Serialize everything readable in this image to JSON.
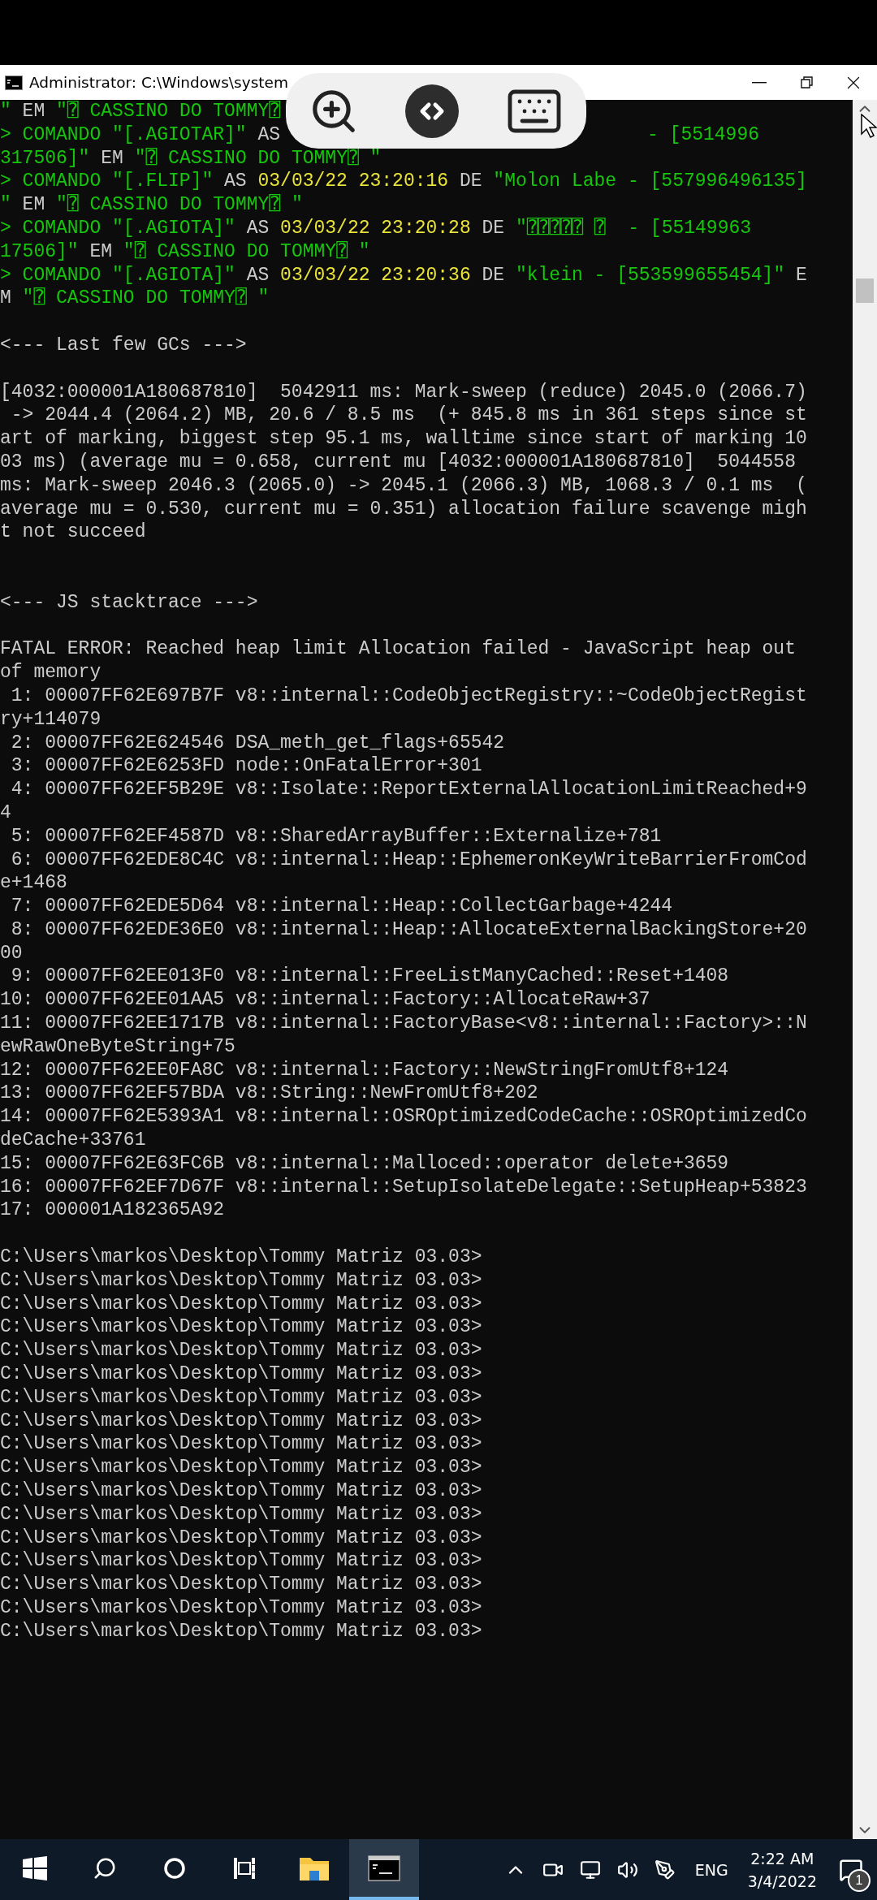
{
  "window": {
    "title": "Administrator: C:\\Windows\\system"
  },
  "console": {
    "lines": [
      {
        "kind": "covered",
        "left": [
          {
            "text": "\"",
            "color": "#16c60c"
          },
          {
            "text": " EM ",
            "color": "#cccccc"
          },
          {
            "text": "\"⍰ CASSINO DO TOMMY⍰",
            "color": "#16c60c"
          }
        ]
      },
      {
        "kind": "covered",
        "left": [
          {
            "text": "> COMANDO \"[.AGIOTAR]\"",
            "color": "#16c60c"
          },
          {
            "text": " AS",
            "color": "#cccccc"
          }
        ],
        "right": [
          {
            "text": "- [5514996",
            "color": "#16c60c"
          }
        ]
      },
      {
        "kind": "colored",
        "segments": [
          {
            "text": "317506]\"",
            "color": "#16c60c"
          },
          {
            "text": " EM ",
            "color": "#cccccc"
          },
          {
            "text": "\"⍰ CASSINO DO TOMMY⍰ \"",
            "color": "#16c60c"
          }
        ]
      },
      {
        "kind": "colored",
        "segments": [
          {
            "text": "> COMANDO \"[.FLIP]\"",
            "color": "#16c60c"
          },
          {
            "text": " AS ",
            "color": "#cccccc"
          },
          {
            "text": "03/03/22 23:20:16",
            "color": "#eae33a"
          },
          {
            "text": " DE ",
            "color": "#cccccc"
          },
          {
            "text": "\"Molon Labe - [557996496135]",
            "color": "#16c60c"
          }
        ]
      },
      {
        "kind": "colored",
        "segments": [
          {
            "text": "\"",
            "color": "#16c60c"
          },
          {
            "text": " EM ",
            "color": "#cccccc"
          },
          {
            "text": "\"⍰ CASSINO DO TOMMY⍰ \"",
            "color": "#16c60c"
          }
        ]
      },
      {
        "kind": "colored",
        "segments": [
          {
            "text": "> COMANDO \"[.AGIOTA]\"",
            "color": "#16c60c"
          },
          {
            "text": " AS ",
            "color": "#cccccc"
          },
          {
            "text": "03/03/22 23:20:28",
            "color": "#eae33a"
          },
          {
            "text": " DE ",
            "color": "#cccccc"
          },
          {
            "text": "\"⍰⍰⍰⍰⍰ ⍰  - [55149963",
            "color": "#16c60c"
          }
        ]
      },
      {
        "kind": "colored",
        "segments": [
          {
            "text": "17506]\"",
            "color": "#16c60c"
          },
          {
            "text": " EM ",
            "color": "#cccccc"
          },
          {
            "text": "\"⍰ CASSINO DO TOMMY⍰ \"",
            "color": "#16c60c"
          }
        ]
      },
      {
        "kind": "colored",
        "segments": [
          {
            "text": "> COMANDO \"[.AGIOTA]\"",
            "color": "#16c60c"
          },
          {
            "text": " AS ",
            "color": "#cccccc"
          },
          {
            "text": "03/03/22 23:20:36",
            "color": "#eae33a"
          },
          {
            "text": " DE ",
            "color": "#cccccc"
          },
          {
            "text": "\"klein - [553599655454]\"",
            "color": "#16c60c"
          },
          {
            "text": " E",
            "color": "#cccccc"
          }
        ]
      },
      {
        "kind": "colored",
        "segments": [
          {
            "text": "M ",
            "color": "#cccccc"
          },
          {
            "text": "\"⍰ CASSINO DO TOMMY⍰ \"",
            "color": "#16c60c"
          }
        ]
      },
      {
        "kind": "blank"
      },
      {
        "kind": "text",
        "text": "<--- Last few GCs --->"
      },
      {
        "kind": "blank"
      },
      {
        "kind": "text",
        "text": "[4032:000001A180687810]  5042911 ms: Mark-sweep (reduce) 2045.0 (2066.7)"
      },
      {
        "kind": "text",
        "text": " -> 2044.4 (2064.2) MB, 20.6 / 8.5 ms  (+ 845.8 ms in 361 steps since st"
      },
      {
        "kind": "text",
        "text": "art of marking, biggest step 95.1 ms, walltime since start of marking 10"
      },
      {
        "kind": "text",
        "text": "03 ms) (average mu = 0.658, current mu [4032:000001A180687810]  5044558"
      },
      {
        "kind": "text",
        "text": "ms: Mark-sweep 2046.3 (2065.0) -> 2045.1 (2066.3) MB, 1068.3 / 0.1 ms  ("
      },
      {
        "kind": "text",
        "text": "average mu = 0.530, current mu = 0.351) allocation failure scavenge migh"
      },
      {
        "kind": "text",
        "text": "t not succeed"
      },
      {
        "kind": "blank"
      },
      {
        "kind": "blank"
      },
      {
        "kind": "text",
        "text": "<--- JS stacktrace --->"
      },
      {
        "kind": "blank"
      },
      {
        "kind": "text",
        "text": "FATAL ERROR: Reached heap limit Allocation failed - JavaScript heap out"
      },
      {
        "kind": "text",
        "text": "of memory"
      },
      {
        "kind": "text",
        "text": " 1: 00007FF62E697B7F v8::internal::CodeObjectRegistry::~CodeObjectRegist"
      },
      {
        "kind": "text",
        "text": "ry+114079"
      },
      {
        "kind": "text",
        "text": " 2: 00007FF62E624546 DSA_meth_get_flags+65542"
      },
      {
        "kind": "text",
        "text": " 3: 00007FF62E6253FD node::OnFatalError+301"
      },
      {
        "kind": "text",
        "text": " 4: 00007FF62EF5B29E v8::Isolate::ReportExternalAllocationLimitReached+9"
      },
      {
        "kind": "text",
        "text": "4"
      },
      {
        "kind": "text",
        "text": " 5: 00007FF62EF4587D v8::SharedArrayBuffer::Externalize+781"
      },
      {
        "kind": "text",
        "text": " 6: 00007FF62EDE8C4C v8::internal::Heap::EphemeronKeyWriteBarrierFromCod"
      },
      {
        "kind": "text",
        "text": "e+1468"
      },
      {
        "kind": "text",
        "text": " 7: 00007FF62EDE5D64 v8::internal::Heap::CollectGarbage+4244"
      },
      {
        "kind": "text",
        "text": " 8: 00007FF62EDE36E0 v8::internal::Heap::AllocateExternalBackingStore+20"
      },
      {
        "kind": "text",
        "text": "00"
      },
      {
        "kind": "text",
        "text": " 9: 00007FF62EE013F0 v8::internal::FreeListManyCached::Reset+1408"
      },
      {
        "kind": "text",
        "text": "10: 00007FF62EE01AA5 v8::internal::Factory::AllocateRaw+37"
      },
      {
        "kind": "text",
        "text": "11: 00007FF62EE1717B v8::internal::FactoryBase<v8::internal::Factory>::N"
      },
      {
        "kind": "text",
        "text": "ewRawOneByteString+75"
      },
      {
        "kind": "text",
        "text": "12: 00007FF62EE0FA8C v8::internal::Factory::NewStringFromUtf8+124"
      },
      {
        "kind": "text",
        "text": "13: 00007FF62EF57BDA v8::String::NewFromUtf8+202"
      },
      {
        "kind": "text",
        "text": "14: 00007FF62E5393A1 v8::internal::OSROptimizedCodeCache::OSROptimizedCo"
      },
      {
        "kind": "text",
        "text": "deCache+33761"
      },
      {
        "kind": "text",
        "text": "15: 00007FF62E63FC6B v8::internal::Malloced::operator delete+3659"
      },
      {
        "kind": "text",
        "text": "16: 00007FF62EF7D67F v8::internal::SetupIsolateDelegate::SetupHeap+53823"
      },
      {
        "kind": "text",
        "text": "17: 000001A182365A92"
      },
      {
        "kind": "blank"
      },
      {
        "kind": "text",
        "text": "C:\\Users\\markos\\Desktop\\Tommy Matriz 03.03>"
      },
      {
        "kind": "text",
        "text": "C:\\Users\\markos\\Desktop\\Tommy Matriz 03.03>"
      },
      {
        "kind": "text",
        "text": "C:\\Users\\markos\\Desktop\\Tommy Matriz 03.03>"
      },
      {
        "kind": "text",
        "text": "C:\\Users\\markos\\Desktop\\Tommy Matriz 03.03>"
      },
      {
        "kind": "text",
        "text": "C:\\Users\\markos\\Desktop\\Tommy Matriz 03.03>"
      },
      {
        "kind": "text",
        "text": "C:\\Users\\markos\\Desktop\\Tommy Matriz 03.03>"
      },
      {
        "kind": "text",
        "text": "C:\\Users\\markos\\Desktop\\Tommy Matriz 03.03>"
      },
      {
        "kind": "text",
        "text": "C:\\Users\\markos\\Desktop\\Tommy Matriz 03.03>"
      },
      {
        "kind": "text",
        "text": "C:\\Users\\markos\\Desktop\\Tommy Matriz 03.03>"
      },
      {
        "kind": "text",
        "text": "C:\\Users\\markos\\Desktop\\Tommy Matriz 03.03>"
      },
      {
        "kind": "text",
        "text": "C:\\Users\\markos\\Desktop\\Tommy Matriz 03.03>"
      },
      {
        "kind": "text",
        "text": "C:\\Users\\markos\\Desktop\\Tommy Matriz 03.03>"
      },
      {
        "kind": "text",
        "text": "C:\\Users\\markos\\Desktop\\Tommy Matriz 03.03>"
      },
      {
        "kind": "text",
        "text": "C:\\Users\\markos\\Desktop\\Tommy Matriz 03.03>"
      },
      {
        "kind": "text",
        "text": "C:\\Users\\markos\\Desktop\\Tommy Matriz 03.03>"
      },
      {
        "kind": "text",
        "text": "C:\\Users\\markos\\Desktop\\Tommy Matriz 03.03>"
      },
      {
        "kind": "text",
        "text": "C:\\Users\\markos\\Desktop\\Tommy Matriz 03.03>"
      }
    ]
  },
  "taskbar": {
    "apps": [
      {
        "kind": "folder",
        "selected": false
      },
      {
        "kind": "terminal",
        "selected": true
      }
    ],
    "language": "ENG",
    "time": "2:22 AM",
    "date": "3/4/2022",
    "notification_count": "1"
  }
}
